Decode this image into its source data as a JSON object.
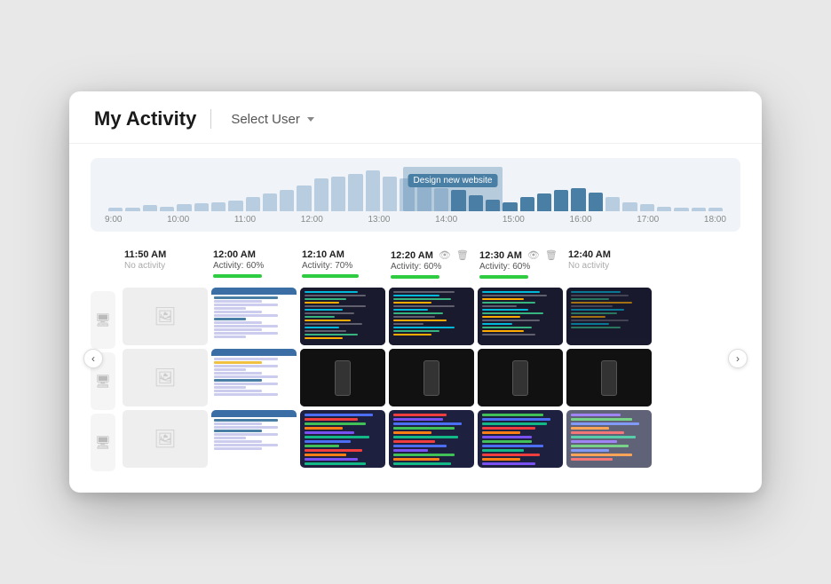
{
  "header": {
    "title": "My Activity",
    "select_user_label": "Select User"
  },
  "timeline": {
    "highlight_label": "Design new website",
    "ticks": [
      "9:00",
      "10:00",
      "11:00",
      "12:00",
      "13:00",
      "14:00",
      "15:00",
      "16:00",
      "17:00",
      "18:00"
    ],
    "bars": [
      2,
      3,
      5,
      4,
      6,
      7,
      8,
      9,
      12,
      15,
      18,
      22,
      28,
      30,
      32,
      35,
      30,
      28,
      25,
      20,
      18,
      14,
      10,
      8,
      12,
      15,
      18,
      20,
      16,
      12,
      8,
      6,
      4,
      3,
      2,
      2
    ],
    "active_range": [
      20,
      28
    ]
  },
  "slots": [
    {
      "time": "11:50 AM",
      "activity_label": "No activity",
      "activity_pct": 0,
      "has_bar": false
    },
    {
      "time": "12:00 AM",
      "activity_label": "Activity: 60%",
      "activity_pct": 60,
      "has_bar": true,
      "has_icons": true
    },
    {
      "time": "12:10 AM",
      "activity_label": "Activity: 70%",
      "activity_pct": 70,
      "has_bar": true,
      "has_icons": false
    },
    {
      "time": "12:20 AM",
      "activity_label": "Activity: 60%",
      "activity_pct": 60,
      "has_bar": true,
      "has_icons": true
    },
    {
      "time": "12:30 AM",
      "activity_label": "Activity: 60%",
      "activity_pct": 60,
      "has_bar": true,
      "has_icons": true
    },
    {
      "time": "12:40 AM",
      "activity_label": "No activity",
      "activity_pct": 0,
      "has_bar": false,
      "has_icons": false
    }
  ],
  "rows": [
    {
      "type": "web",
      "icon": "monitor"
    },
    {
      "type": "web",
      "icon": "monitor"
    },
    {
      "type": "colorful",
      "icon": "monitor"
    }
  ],
  "icons": {
    "monitor": "🖥",
    "eye": "👁",
    "trash": "🗑",
    "chevron_left": "‹",
    "chevron_right": "›",
    "chevron_down": "▾",
    "placeholder": "🖼"
  }
}
